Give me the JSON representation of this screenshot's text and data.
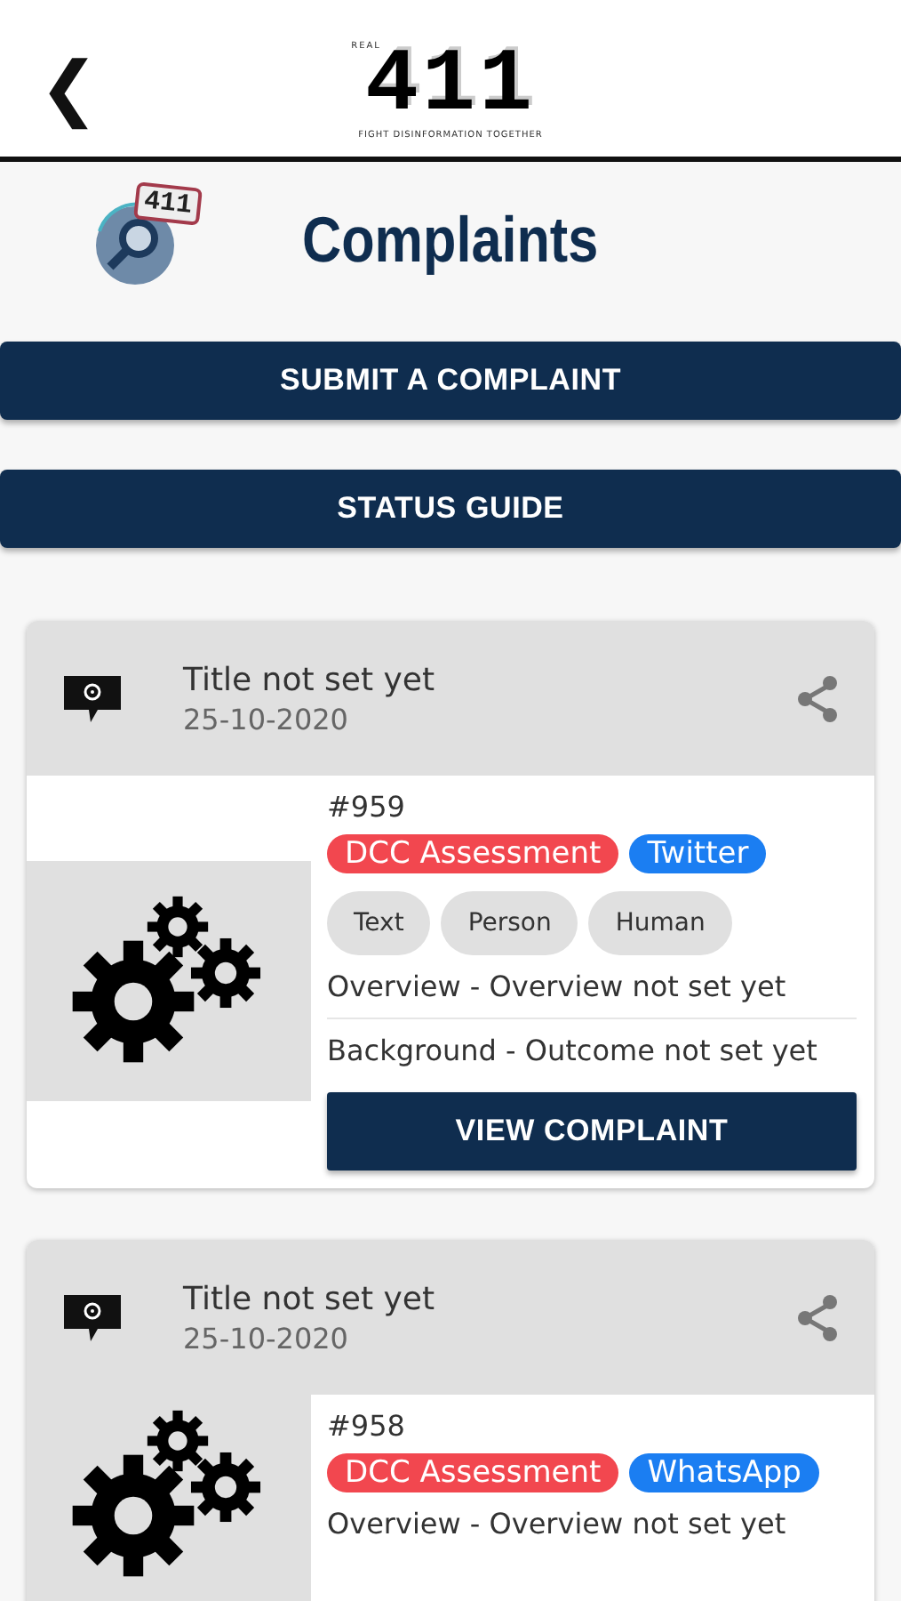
{
  "header": {
    "back_icon": "❮",
    "logo": {
      "small_label": "REAL",
      "main": "411",
      "tagline": "FIGHT DISINFORMATION TOGETHER"
    }
  },
  "page": {
    "badge": "411",
    "title": "Complaints"
  },
  "actions": [
    "SUBMIT A COMPLAINT",
    "STATUS GUIDE"
  ],
  "complaints": [
    {
      "title": "Title not set yet",
      "date": "25-10-2020",
      "number": "#959",
      "tags": [
        {
          "label": "DCC Assessment",
          "color": "#f2474f"
        },
        {
          "label": "Twitter",
          "color": "#1b7ef2"
        }
      ],
      "chips": [
        "Text",
        "Person",
        "Human"
      ],
      "overview": "Overview - Overview not set yet",
      "background": "Background - Outcome not set yet",
      "button": "VIEW COMPLAINT"
    },
    {
      "title": "Title not set yet",
      "date": "25-10-2020",
      "number": "#958",
      "tags": [
        {
          "label": "DCC Assessment",
          "color": "#f2474f"
        },
        {
          "label": "WhatsApp",
          "color": "#1b7ef2"
        }
      ],
      "overview": "Overview - Overview not set yet"
    }
  ]
}
